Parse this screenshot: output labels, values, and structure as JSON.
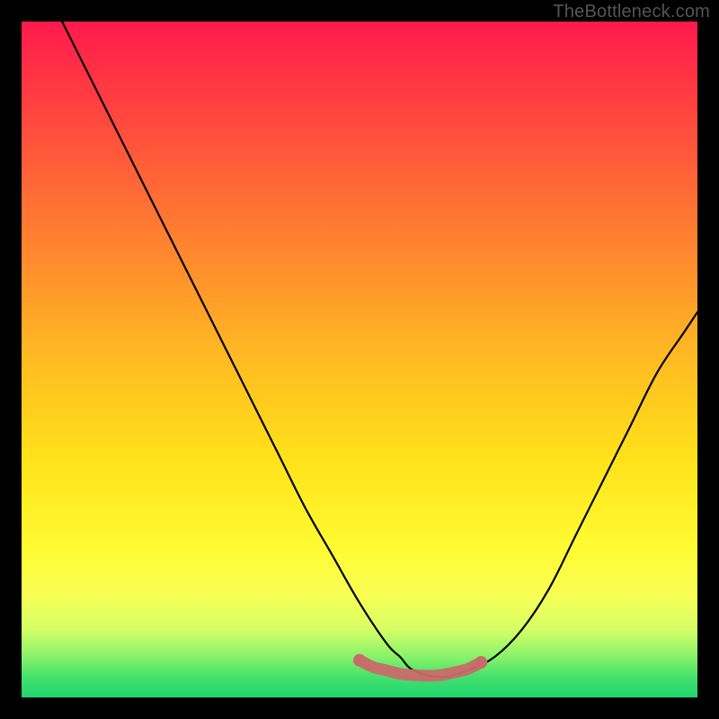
{
  "credit_text": "TheBottleneck.com",
  "chart_data": {
    "type": "line",
    "title": "",
    "xlabel": "",
    "ylabel": "",
    "xlim": [
      0,
      100
    ],
    "ylim": [
      0,
      100
    ],
    "gradient_stops": [
      {
        "pos": 0,
        "color": "#ff1a4d"
      },
      {
        "pos": 8,
        "color": "#ff3344"
      },
      {
        "pos": 20,
        "color": "#ff5a3a"
      },
      {
        "pos": 35,
        "color": "#ff8a2d"
      },
      {
        "pos": 50,
        "color": "#ffbb22"
      },
      {
        "pos": 65,
        "color": "#ffe21a"
      },
      {
        "pos": 78,
        "color": "#fffb33"
      },
      {
        "pos": 85,
        "color": "#f7ff55"
      },
      {
        "pos": 90,
        "color": "#d4ff66"
      },
      {
        "pos": 94,
        "color": "#88f26a"
      },
      {
        "pos": 97,
        "color": "#44e06c"
      },
      {
        "pos": 100,
        "color": "#1fd66f"
      }
    ],
    "series": [
      {
        "name": "main-curve",
        "color": "#000000",
        "x": [
          6,
          10,
          14,
          18,
          22,
          26,
          30,
          34,
          38,
          42,
          46,
          50,
          54,
          56,
          58,
          62,
          66,
          70,
          74,
          78,
          82,
          86,
          90,
          94,
          98,
          100
        ],
        "y": [
          100,
          92,
          84,
          76,
          68,
          60,
          52,
          44,
          36,
          28,
          21,
          14,
          8,
          6,
          4,
          3,
          4,
          6,
          10,
          16,
          24,
          32,
          40,
          48,
          54,
          57
        ]
      },
      {
        "name": "highlight-band",
        "color": "#c96a6a",
        "x": [
          50,
          52,
          54,
          56,
          58,
          60,
          62,
          64,
          66,
          68
        ],
        "y": [
          5.5,
          4.5,
          4,
          3.5,
          3.3,
          3.2,
          3.3,
          3.7,
          4.2,
          5.2
        ]
      }
    ]
  }
}
